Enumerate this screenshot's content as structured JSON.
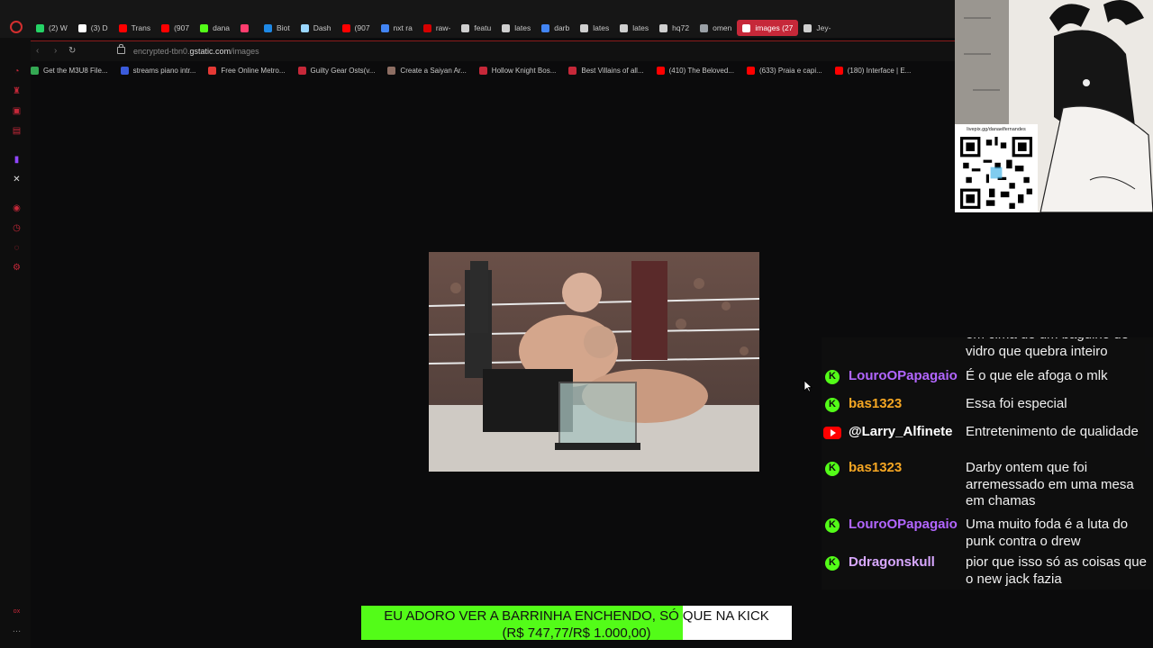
{
  "browser": {
    "tabs": [
      {
        "label": "(2) W",
        "color": "#25d366"
      },
      {
        "label": "(3) D",
        "color": "#ffffff"
      },
      {
        "label": "Trans",
        "color": "#ff0000"
      },
      {
        "label": "(907",
        "color": "#ff0000"
      },
      {
        "label": "dana",
        "color": "#53fc18"
      },
      {
        "label": "",
        "color": "#ff3d6e"
      },
      {
        "label": "Biot",
        "color": "#1e88e5"
      },
      {
        "label": "Dash",
        "color": "#9ad7ff"
      },
      {
        "label": "(907",
        "color": "#ff0000"
      },
      {
        "label": "nxt ra",
        "color": "#4285f4"
      },
      {
        "label": "raw-",
        "color": "#d50000"
      },
      {
        "label": "featu",
        "color": "#cfcfcf"
      },
      {
        "label": "lates",
        "color": "#cfcfcf"
      },
      {
        "label": "darb",
        "color": "#4285f4"
      },
      {
        "label": "lates",
        "color": "#cfcfcf"
      },
      {
        "label": "lates",
        "color": "#cfcfcf"
      },
      {
        "label": "hq72",
        "color": "#cfcfcf"
      },
      {
        "label": "omen",
        "color": "#9aa0a6"
      },
      {
        "label": "images (27",
        "color": "#ffffff",
        "active": true
      },
      {
        "label": "Jey-",
        "color": "#cfcfcf"
      }
    ],
    "url_prefix": "encrypted-tbn0.",
    "url_host": "gstatic.com",
    "url_path": "/images",
    "bookmarks": [
      {
        "label": "Get the M3U8 File...",
        "color": "#34a853"
      },
      {
        "label": "streams piano intr...",
        "color": "#3b5bdb"
      },
      {
        "label": "Free Online Metro...",
        "color": "#e53935"
      },
      {
        "label": "Guilty Gear Osts(v...",
        "color": "#c62839"
      },
      {
        "label": "Create a Saiyan Ar...",
        "color": "#8d6e63"
      },
      {
        "label": "Hollow Knight Bos...",
        "color": "#c62839"
      },
      {
        "label": "Best Villains of all...",
        "color": "#c62839"
      },
      {
        "label": "(410) The Beloved...",
        "color": "#ff0000"
      },
      {
        "label": "(633) Praia e capi...",
        "color": "#ff0000"
      },
      {
        "label": "(180) Interface | E...",
        "color": "#ff0000"
      }
    ]
  },
  "overlay": {
    "qr_caption": "livepix.gg/danaelfernandes"
  },
  "chat": {
    "messages": [
      {
        "platform": "kick",
        "user": "",
        "user_color": "#ffffff",
        "text": "em cima de um bagulho de vidro que quebra inteiro"
      },
      {
        "platform": "kick",
        "user": "LouroOPapagaio",
        "user_color": "#b266ff",
        "text": "É o que ele afoga o mlk"
      },
      {
        "platform": "kick",
        "user": "bas1323",
        "user_color": "#f5a623",
        "text": "Essa foi especial"
      },
      {
        "platform": "youtube",
        "user": "@Larry_Alfinete",
        "user_color": "#ffffff",
        "text": "Entretenimento de qualidade"
      },
      {
        "platform": "kick",
        "user": "bas1323",
        "user_color": "#f5a623",
        "text": "Darby ontem que foi arremessado em uma mesa em chamas"
      },
      {
        "platform": "kick",
        "user": "LouroOPapagaio",
        "user_color": "#b266ff",
        "text": "Uma muito foda é a luta do punk contra o drew"
      },
      {
        "platform": "kick",
        "user": "Ddragonskull",
        "user_color": "#d8a8ff",
        "text": "pior que isso só as coisas que o new jack fazia"
      }
    ]
  },
  "goal": {
    "line1": "EU ADORO VER A BARRINHA ENCHENDO, SÓ QUE NA KICK",
    "line2": "(R$ 747,77/R$ 1.000,00)",
    "current": 747.77,
    "target": 1000,
    "fill_color": "#53fc18"
  }
}
